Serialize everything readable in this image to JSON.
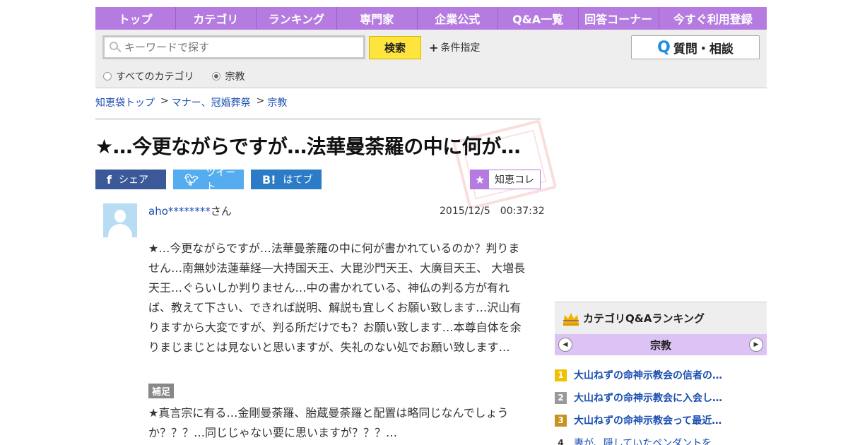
{
  "nav": {
    "items": [
      "トップ",
      "カテゴリ",
      "ランキング",
      "専門家",
      "企業公式",
      "Q&A一覧",
      "回答コーナー",
      "今すぐ利用登録"
    ]
  },
  "search": {
    "placeholder": "キーワードで探す",
    "button_label": "検索",
    "condition_label": "条件指定",
    "ask_label": "質問・相談",
    "radio_all": "すべてのカテゴリ",
    "radio_current": "宗教",
    "selected": "宗教"
  },
  "breadcrumb": [
    "知恵袋トップ",
    "マナー、冠婚葬祭",
    "宗教"
  ],
  "question": {
    "title": "★…今更ながらですが…法華曼荼羅の中に何が…",
    "user_masked": "aho********",
    "user_suffix": "さん",
    "datetime": "2015/12/5　00:37:32",
    "body": "★…今更ながらですが…法華曼荼羅の中に何が書かれているのか？判りません…南無妙法蓮華経―大持国天王、大毘沙門天王、大廣目天王、 大増長天王…ぐらいしか判りません…中の書かれている、神仏の判る方が有れば、教えて下さい、できれば説明、解説も宜しくお願い致します…沢山有りますから大変ですが、判る所だけでも？お願い致します…本尊自体を余りまじまじとは見ないと思いますが、失礼のない処でお願い致します…",
    "supplement_tag": "補足",
    "supplement": "★真言宗に有る…金剛曼荼羅、胎蔵曼荼羅と配置は略同じなんでしょうか？？？…同じじゃない要に思いますが？？？…"
  },
  "share": {
    "facebook": "シェア",
    "twitter": "ツイート",
    "hatena": "はてブ",
    "chiecolle": "知恵コレ"
  },
  "ranking": {
    "title": "カテゴリQ&Aランキング",
    "category": "宗教",
    "items": [
      {
        "rank": "1",
        "text": "大山ねずの命神示教会の信者の…"
      },
      {
        "rank": "2",
        "text": "大山ねずの命神示教会に入会し…"
      },
      {
        "rank": "3",
        "text": "大山ねずの命神示教会って最近…"
      },
      {
        "rank": "4",
        "text": "妻が、隠していたペンダントを…"
      }
    ]
  },
  "colors": {
    "nav_bg": "#b57be0",
    "link": "#1a4fb0",
    "search_button": "#ffe43d",
    "facebook": "#3b5998",
    "twitter": "#55acee",
    "hatena": "#2c7bc7"
  }
}
